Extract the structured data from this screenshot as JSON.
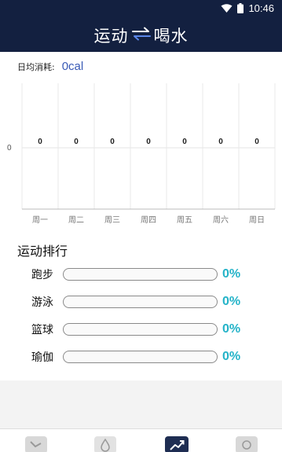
{
  "status": {
    "time": "10:46"
  },
  "header": {
    "title_left": "运动",
    "title_right": "喝水"
  },
  "daily": {
    "label": "日均消耗:",
    "value": "0cal"
  },
  "chart_data": {
    "type": "bar",
    "categories": [
      "周一",
      "周二",
      "周三",
      "周四",
      "周五",
      "周六",
      "周日"
    ],
    "values": [
      0,
      0,
      0,
      0,
      0,
      0,
      0
    ],
    "y_tick": "0",
    "grid": true
  },
  "ranking": {
    "title": "运动排行",
    "items": [
      {
        "name": "跑步",
        "percent": "0%",
        "fraction": 0
      },
      {
        "name": "游泳",
        "percent": "0%",
        "fraction": 0
      },
      {
        "name": "篮球",
        "percent": "0%",
        "fraction": 0
      },
      {
        "name": "瑜伽",
        "percent": "0%",
        "fraction": 0
      }
    ]
  },
  "tabs": [
    {
      "icon": "sport-shoe-icon",
      "active": false
    },
    {
      "icon": "water-drop-icon",
      "active": false
    },
    {
      "icon": "chart-trend-icon",
      "active": true
    },
    {
      "icon": "profile-icon",
      "active": false
    }
  ],
  "colors": {
    "header": "#132040",
    "accent": "#24b3c8",
    "tab_active": "#1e2d52"
  }
}
